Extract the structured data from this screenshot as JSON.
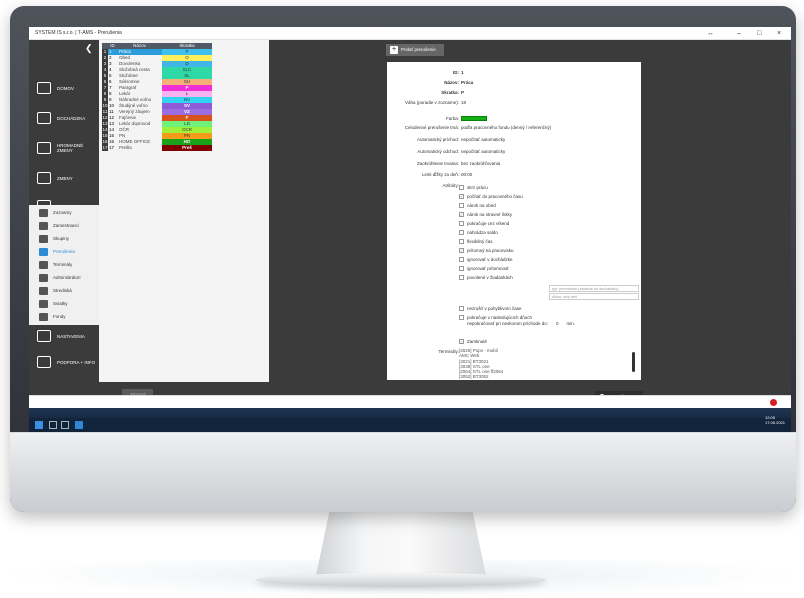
{
  "window": {
    "title": "SYSTEM IS s.r.o. | T-AMS - Prerušenia"
  },
  "sidebar": {
    "main_items": [
      {
        "label": "Domov",
        "icon": "home-icon"
      },
      {
        "label": "Dochádzka",
        "icon": "clock-icon"
      },
      {
        "label": "Hromadné zmeny",
        "icon": "calendar-icon"
      },
      {
        "label": "Zmeny",
        "icon": "shift-icon"
      },
      {
        "label": "Prehľady",
        "icon": "overview-icon"
      }
    ],
    "sub_items": [
      {
        "label": "Zoznamy",
        "icon": "list-icon"
      },
      {
        "label": "Zamestnanci",
        "icon": "users-icon"
      },
      {
        "label": "Skupiny",
        "icon": "groups-icon"
      },
      {
        "label": "Prerušenia",
        "icon": "interruption-icon",
        "active": true
      },
      {
        "label": "Terminály",
        "icon": "terminal-icon"
      },
      {
        "label": "Administrátori",
        "icon": "admin-icon"
      },
      {
        "label": "Strediská",
        "icon": "building-icon"
      },
      {
        "label": "Sviatky",
        "icon": "holiday-icon"
      },
      {
        "label": "Fondy",
        "icon": "fund-icon"
      }
    ],
    "bottom_items": [
      {
        "label": "Nastavenia",
        "icon": "settings-icon"
      },
      {
        "label": "Podpora + Info",
        "icon": "help-icon"
      }
    ]
  },
  "table": {
    "headers": [
      "ID",
      "Názov",
      "Skratka"
    ],
    "rows": [
      {
        "num": "1",
        "id": "1",
        "name": "Práca",
        "abbr": "P",
        "color": "#3ec1f0",
        "selected": true
      },
      {
        "num": "2",
        "id": "2",
        "name": "Obed",
        "abbr": "O",
        "color": "#ffef5a"
      },
      {
        "num": "3",
        "id": "3",
        "name": "Dovolenka",
        "abbr": "D",
        "color": "#43b6e8"
      },
      {
        "num": "4",
        "id": "4",
        "name": "Služobná cesta",
        "abbr": "SLC",
        "color": "#2fd9a6"
      },
      {
        "num": "5",
        "id": "5",
        "name": "Služobne",
        "abbr": "SL",
        "color": "#2fd9a6"
      },
      {
        "num": "6",
        "id": "6",
        "name": "Súkromne",
        "abbr": "SU",
        "color": "#f5b078"
      },
      {
        "num": "7",
        "id": "7",
        "name": "Paragraf",
        "abbr": "P",
        "color": "#f02ed6"
      },
      {
        "num": "8",
        "id": "8",
        "name": "Lekár",
        "abbr": "L",
        "color": "#f7b3f0"
      },
      {
        "num": "9",
        "id": "9",
        "name": "Náhradné voľno",
        "abbr": "NV",
        "color": "#31d2f2"
      },
      {
        "num": "10",
        "id": "10",
        "name": "Študijné voľno",
        "abbr": "SV",
        "color": "#8e5ad8"
      },
      {
        "num": "11",
        "id": "11",
        "name": "Verejný záujem",
        "abbr": "VZ",
        "color": "#9a6ee0"
      },
      {
        "num": "12",
        "id": "12",
        "name": "Fajčenie",
        "abbr": "F",
        "color": "#d7531a"
      },
      {
        "num": "13",
        "id": "13",
        "name": "Lekár doprovod",
        "abbr": "LD",
        "color": "#6ef27a"
      },
      {
        "num": "14",
        "id": "14",
        "name": "OČR",
        "abbr": "OCR",
        "color": "#a0f03c"
      },
      {
        "num": "15",
        "id": "15",
        "name": "PN",
        "abbr": "PN",
        "color": "#f59b1a"
      },
      {
        "num": "16",
        "id": "16",
        "name": "HOME OFFICE",
        "abbr": "HO",
        "color": "#18a318"
      },
      {
        "num": "17",
        "id": "17",
        "name": "Prešla",
        "abbr": "Preš",
        "color": "#800000"
      }
    ]
  },
  "toolbar": {
    "add_label": "Pridať prerušenie",
    "edit_label": "Upraviť",
    "delete_label": "Zmazať"
  },
  "detail": {
    "id_label": "ID:",
    "id_value": "1",
    "name_label": "Názov:",
    "name_value": "Práca",
    "abbr_label": "Skratka:",
    "abbr_value": "P",
    "weight_label": "Váha (poradie v zozname):",
    "weight_value": "18",
    "color_label": "Farba:",
    "color_value": "#13b013",
    "duration_label": "Celodenné prerušenie trvá:",
    "duration_value": "podľa pracovného fondu (denný / referenčný)",
    "auto_in_label": "Automatický príchod:",
    "auto_in_value": "nepočítať automaticky",
    "auto_out_label": "Automatický odchod:",
    "auto_out_value": "nepočítať automaticky",
    "round_label": "Zaokrúhlenie trvania:",
    "round_value": "bez zaokrúhľovania",
    "limit_label": "Limit dĺžky za deň:",
    "limit_value": "00:00",
    "attributes_label": "Atribúty:",
    "attributes": [
      {
        "label": "skrz prácu",
        "checked": false
      },
      {
        "label": "počítať do pracovného času",
        "checked": true
      },
      {
        "label": "nárok na obed",
        "checked": false
      },
      {
        "label": "nárok na stravné lístky",
        "checked": true
      },
      {
        "label": "pokračuje cez víkend",
        "checked": false
      },
      {
        "label": "nahrádza saldo",
        "checked": false
      },
      {
        "label": "flexibilný čas",
        "checked": false
      },
      {
        "label": "prítomný na pracovisku",
        "checked": true
      },
      {
        "label": "ignorovať v dochádzke",
        "checked": false
      },
      {
        "label": "ignorovať prítomnosť",
        "checked": false
      },
      {
        "label": "povolené v žiadankách",
        "checked": false
      }
    ],
    "type_placeholder": "typ: prerušenie (zadanie do dochádzky)",
    "length_placeholder": "dĺžka: celý deň",
    "extra_attributes": [
      {
        "label": "nezrušiť v pohyblivom čase",
        "checked": false
      },
      {
        "label": "pokračuje v nasledujúcich dňoch",
        "checked": false
      }
    ],
    "early_label": "nepokračovať pri neskorom príchode do:",
    "early_value": "0",
    "early_unit": "min.",
    "locked_label": "Zamknuté",
    "terminals_label": "Terminály:",
    "terminals": [
      "[3026] Pops - mobil",
      "AMC Web",
      "[3021] BT3021",
      "[3038] STL one",
      "[2064] STL one ff2064",
      "[3052] BT3052"
    ]
  },
  "status": {
    "time": "12:05",
    "date": "17.06.2021"
  }
}
